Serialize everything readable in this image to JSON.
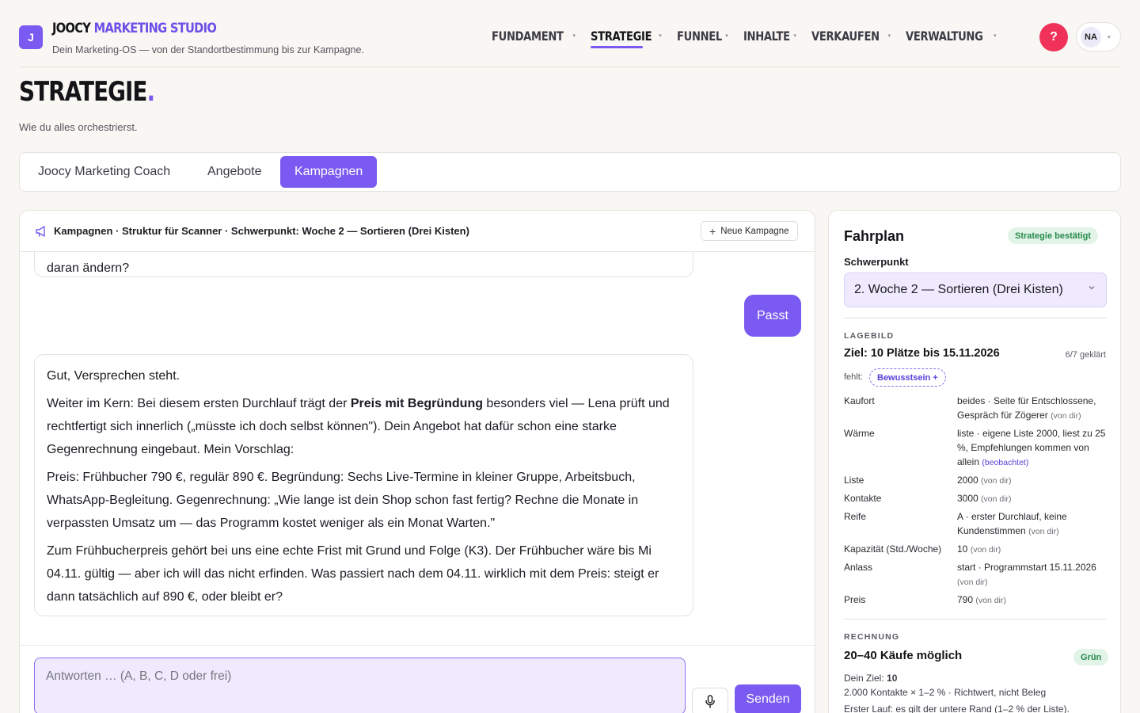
{
  "header": {
    "logo_letter": "J",
    "brand_part1": "JOOCY",
    "brand_part2": "MARKETING STUDIO",
    "tagline": "Dein Marketing-OS — von der Standortbestimmung bis zur Kampagne.",
    "nav": [
      {
        "label": "FUNDAMENT",
        "active": false
      },
      {
        "label": "STRATEGIE",
        "active": true
      },
      {
        "label": "FUNNEL",
        "active": false
      },
      {
        "label": "INHALTE",
        "active": false
      },
      {
        "label": "VERKAUFEN",
        "active": false
      },
      {
        "label": "VERWALTUNG",
        "active": false
      }
    ],
    "help_label": "?",
    "user_initials": "NA"
  },
  "page": {
    "title": "STRATEGIE",
    "title_dot": ".",
    "subtitle": "Wie du alles orchestrierst."
  },
  "tabs": [
    {
      "label": "Joocy Marketing Coach",
      "active": false
    },
    {
      "label": "Angebote",
      "active": false
    },
    {
      "label": "Kampagnen",
      "active": true
    }
  ],
  "chat": {
    "header_title": "Kampagnen · Struktur für Scanner · Schwerpunkt: Woche 2 — Sortieren (Drei Kisten)",
    "new_campaign_label": "Neue Kampagne",
    "prev_bubble_tail": "daran ändern?",
    "user_message": "Passt",
    "bot_message": {
      "p1": "Gut, Versprechen steht.",
      "p2_before": "Weiter im Kern: Bei diesem ersten Durchlauf trägt der ",
      "p2_bold": "Preis mit Begründung",
      "p2_after": " besonders viel — Lena prüft und rechtfertigt sich innerlich („müsste ich doch selbst können\"). Dein Angebot hat dafür schon eine starke Gegenrechnung eingebaut. Mein Vorschlag:",
      "p3": "Preis: Frühbucher 790 €, regulär 890 €. Begründung: Sechs Live-Termine in kleiner Gruppe, Arbeitsbuch, WhatsApp-Begleitung. Gegenrechnung: „Wie lange ist dein Shop schon fast fertig? Rechne die Monate in verpassten Umsatz um — das Programm kostet weniger als ein Monat Warten.\"",
      "p4": "Zum Frühbucherpreis gehört bei uns eine echte Frist mit Grund und Folge (K3). Der Frühbucher wäre bis Mi 04.11. gültig — aber ich will das nicht erfinden. Was passiert nach dem 04.11. wirklich mit dem Preis: steigt er dann tatsächlich auf 890 €, oder bleibt er?"
    },
    "input_placeholder": "Antworten … (A, B, C, D oder frei)",
    "input_value": "",
    "send_label": "Senden"
  },
  "sidebar": {
    "title": "Fahrplan",
    "status_badge": "Strategie bestätigt",
    "focus_label": "Schwerpunkt",
    "focus_value": "2. Woche 2 — Sortieren (Drei Kisten)",
    "situation_eyebrow": "LAGEBILD",
    "goal": "Ziel: 10 Plätze bis 15.11.2026",
    "progress": "6/7 geklärt",
    "missing_label": "fehlt:",
    "missing_chip": "Bewusstsein +",
    "facts": [
      {
        "key": "Kaufort",
        "value": "beides · Seite für Entschlossene, Gespräch für Zögerer",
        "source": "(von dir)",
        "observed": false
      },
      {
        "key": "Wärme",
        "value": "liste · eigene Liste 2000, liest zu 25 %, Empfehlungen kommen von allein",
        "source": "(beobachtet)",
        "observed": true
      },
      {
        "key": "Liste",
        "value": "2000",
        "source": "(von dir)",
        "observed": false
      },
      {
        "key": "Kontakte",
        "value": "3000",
        "source": "(von dir)",
        "observed": false
      },
      {
        "key": "Reife",
        "value": "A · erster Durchlauf, keine Kundenstimmen",
        "source": "(von dir)",
        "observed": false
      },
      {
        "key": "Kapazität (Std./Woche)",
        "value": "10",
        "source": "(von dir)",
        "observed": false
      },
      {
        "key": "Anlass",
        "value": "start · Programmstart 15.11.2026",
        "source": "(von dir)",
        "observed": false
      },
      {
        "key": "Preis",
        "value": "790",
        "source": "(von dir)",
        "observed": false
      }
    ],
    "calc_eyebrow": "RECHNUNG",
    "calc_result": "20–40 Käufe möglich",
    "calc_badge": "Grün",
    "calc_goal_label": "Dein Ziel:",
    "calc_goal_value": "10",
    "calc_formula": "2.000 Kontakte × 1–2 % · Richtwert, nicht Beleg",
    "calc_note": "Erster Lauf: es gilt der untere Rand (1–2 % der Liste)."
  },
  "colors": {
    "accent": "#7a5af0",
    "help": "#f0325a",
    "success": "#258a4c"
  }
}
